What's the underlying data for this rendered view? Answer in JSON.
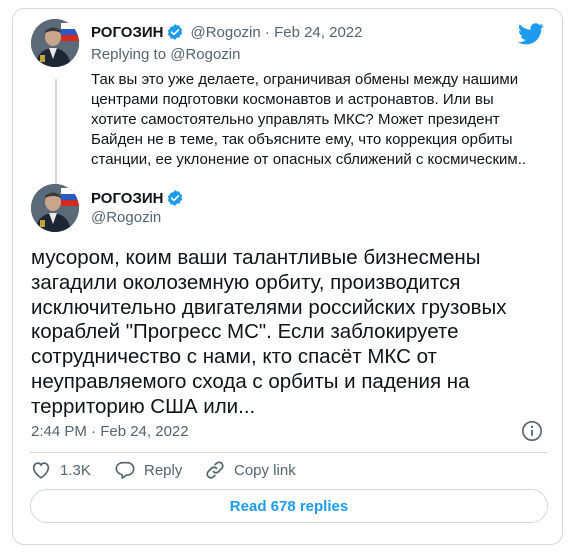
{
  "quoted_tweet": {
    "author_name": "РОГОЗИН",
    "handle": "@Rogozin",
    "separator": " · ",
    "date": "Feb 24, 2022",
    "replying_to_label": "Replying to ",
    "replying_to_handle": "@Rogozin",
    "text_lines": [
      "Так вы это уже делаете, ограничивая обмены между нашими",
      "центрами подготовки космонавтов и астронавтов. Или вы",
      "хотите самостоятельно управлять МКС? Может президент",
      "Байден не в теме, так объясните ему, что коррекция орбиты",
      "станции, ее уклонение от опасных сближений с космическим.."
    ]
  },
  "main_tweet": {
    "author_name": "РОГОЗИН",
    "handle": "@Rogozin",
    "text_lines": [
      "мусором, коим ваши талантливые бизнесмены",
      "загадили околоземную орбиту, производится",
      "исключительно двигателями российских грузовых",
      "кораблей \"Прогресс МС\". Если заблокируете",
      "сотрудничество с нами, кто спасёт МКС от",
      "неуправляемого схода с орбиты и падения на",
      "территорию США или..."
    ],
    "timestamp": "2:44 PM · Feb 24, 2022"
  },
  "actions": {
    "likes": "1.3K",
    "reply_label": "Reply",
    "copy_link_label": "Copy link"
  },
  "read_replies_label": "Read 678 replies",
  "colors": {
    "accent": "#1d9bf0",
    "muted_text": "#536471",
    "border": "#cfd9de",
    "like_icon": "#536471"
  },
  "icons": [
    "twitter-bird-icon",
    "verified-badge-icon",
    "info-icon",
    "heart-icon",
    "reply-bubble-icon",
    "link-icon"
  ]
}
